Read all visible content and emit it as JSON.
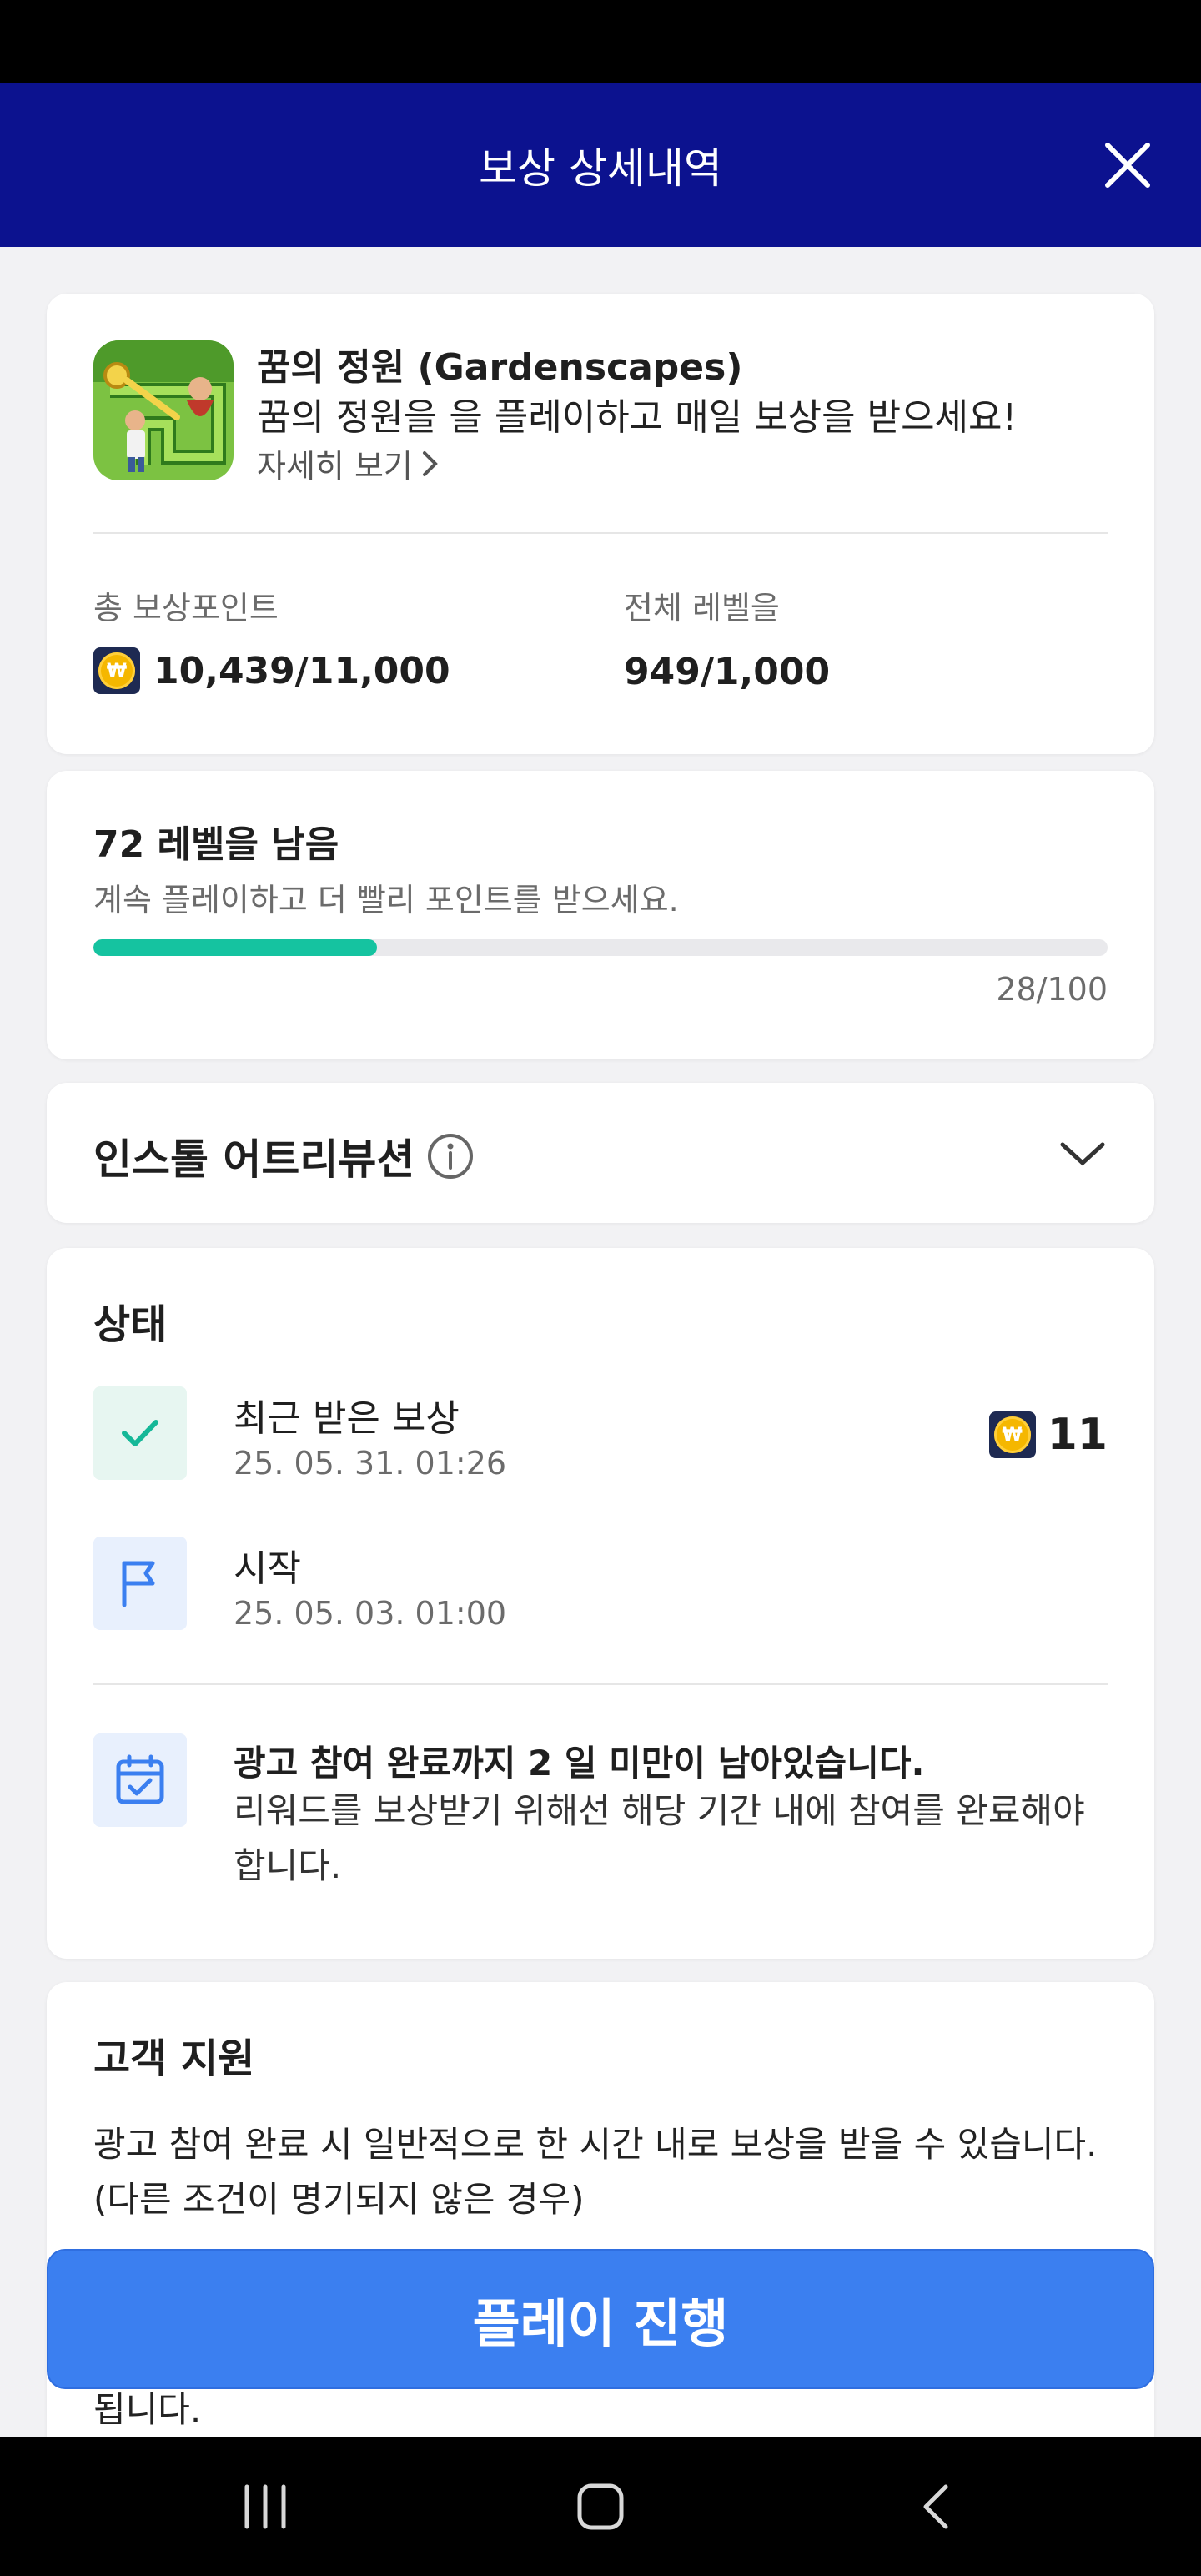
{
  "header": {
    "title": "보상 상세내역"
  },
  "app": {
    "name": "꿈의 정원 (Gardenscapes)",
    "description": "꿈의 정원을 을 플레이하고 매일 보상을 받으세요!",
    "more_link": "자세히 보기"
  },
  "stats": {
    "points_label": "총 보상포인트",
    "points_value": "10,439/11,000",
    "level_label": "전체 레벨을",
    "level_value": "949/1,000"
  },
  "level_progress": {
    "title": "72 레벨을 남음",
    "subtitle": "계속 플레이하고 더 빨리 포인트를 받으세요.",
    "progress_text": "28/100",
    "progress_fraction": 0.28,
    "bar_color": "#15c3a0"
  },
  "attribution": {
    "title": "인스톨 어트리뷰션"
  },
  "status": {
    "title": "상태",
    "rows": [
      {
        "title": "최근 받은 보상",
        "date": "25. 05. 31. 01:26",
        "reward": "11",
        "icon": "check-icon"
      },
      {
        "title": "시작",
        "date": "25. 05. 03. 01:00",
        "icon": "flag-icon"
      }
    ],
    "notice": {
      "title": "광고 참여 완료까지 2 일 미만이 남아있습니다.",
      "body": "리워드를 보상받기 위해선 해당 기간 내에 참여를 완료해야 합니다.",
      "icon": "calendar-check-icon"
    }
  },
  "support": {
    "title": "고객 지원",
    "body": "광고 참여 완료 시 일반적으로 한 시간 내로 보상을 받을 수 있습니다. (다른 조건이 명기되지 않은 경우)",
    "trailing_text": "됩니다."
  },
  "cta": {
    "label": "플레이 진행",
    "color": "#3b7ff0"
  },
  "colors": {
    "header_bg": "#0c128f",
    "accent_green": "#15c3a0",
    "accent_blue": "#3b7ff0"
  },
  "coin_symbol": "₩"
}
